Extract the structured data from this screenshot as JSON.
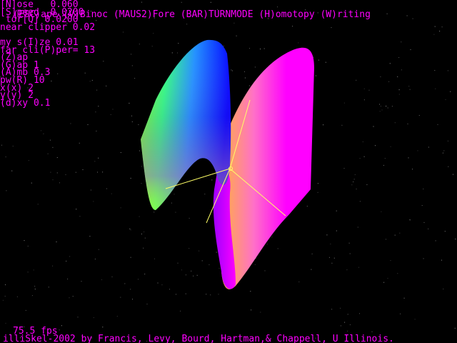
{
  "app": {
    "menu_bar": "(ESC)ape (V)Binoc (MAUS2)Fore (BAR)TURNMODE (H)omotopy (W)riting",
    "credits": "illiSkel-2002 by Francis, Levy, Bourd, Hartman,& Chappell, U Illinois.",
    "fps": "75.5 fps"
  },
  "params": [
    "[N]ose   0.060",
    "[S]peed  0.0200",
    " tor[Q] 0.0200",
    "near clipper 0.02",
    "",
    "my s(I)ze 0.01",
    "far cli(P)per= 13",
    "(Z)ap",
    "(G)ap 1",
    "(A)mb 0.3",
    "pw(R) 10",
    "x(x) 2",
    "y(y) 2",
    "(d)xy 0.1"
  ],
  "colors": {
    "background": "#000000",
    "hud_text": "#ff00ff",
    "axis_lines": "#ffff66",
    "stars": "#8a8a8a"
  }
}
